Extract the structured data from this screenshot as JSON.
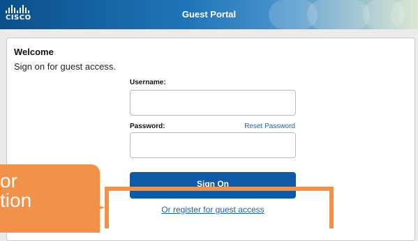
{
  "header": {
    "logo_text": "CISCO",
    "title": "Guest Portal"
  },
  "card": {
    "welcome": "Welcome",
    "subtitle": "Sign on for guest access."
  },
  "form": {
    "username_label": "Username:",
    "username_value": "",
    "password_label": "Password:",
    "password_value": "",
    "reset_link": "Reset Password",
    "signon_button": "Sign On",
    "register_link": "Or register for guest access"
  },
  "annotation": {
    "callout_text": "or\ntion",
    "color": "#f0924a"
  },
  "icons": {
    "logo": "cisco-logo-icon"
  }
}
